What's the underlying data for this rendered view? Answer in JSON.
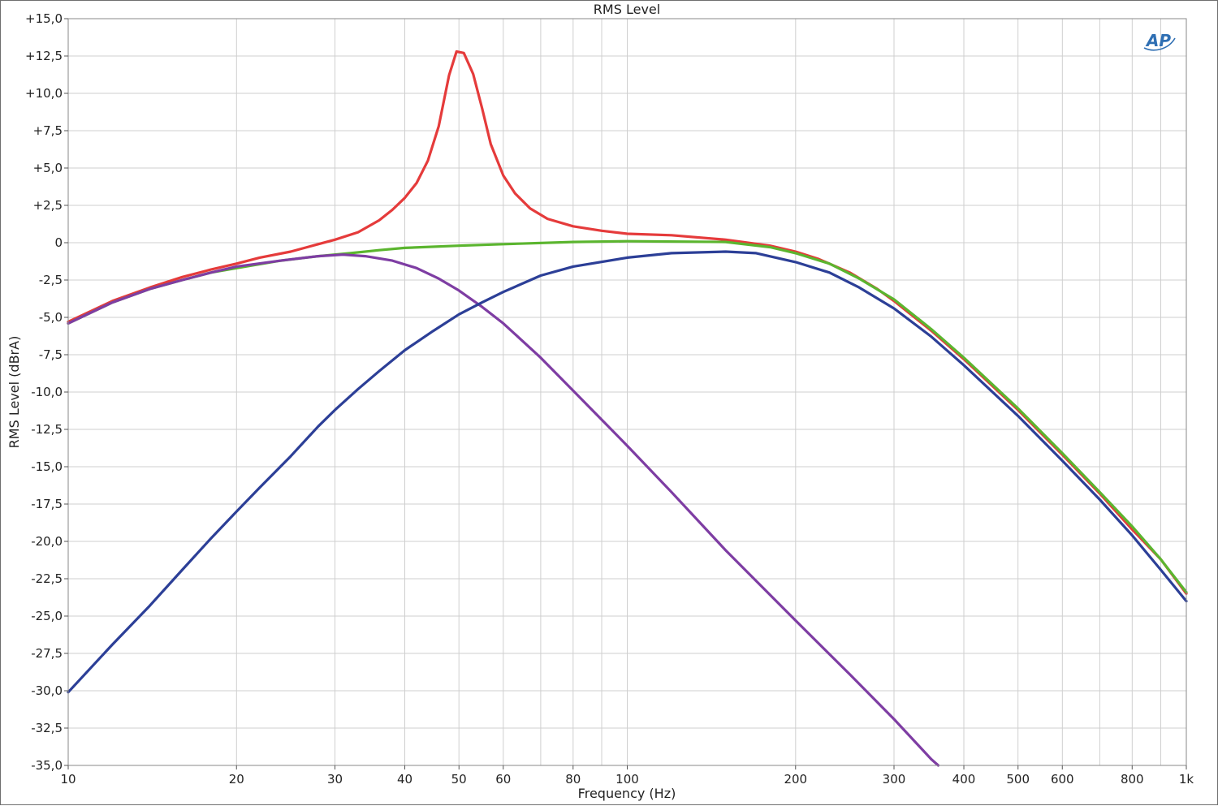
{
  "chart_data": {
    "type": "line",
    "title": "RMS Level",
    "xlabel": "Frequency (Hz)",
    "ylabel": "RMS Level (dBrA)",
    "xscale": "log",
    "xlim": [
      10,
      1000
    ],
    "ylim": [
      -35,
      15
    ],
    "grid": true,
    "legend": "none",
    "logo_text": "AP",
    "x_ticks": [
      {
        "v": 10,
        "label": "10"
      },
      {
        "v": 20,
        "label": "20"
      },
      {
        "v": 30,
        "label": "30"
      },
      {
        "v": 40,
        "label": "40"
      },
      {
        "v": 50,
        "label": "50"
      },
      {
        "v": 60,
        "label": "60"
      },
      {
        "v": 80,
        "label": "80"
      },
      {
        "v": 100,
        "label": "100"
      },
      {
        "v": 200,
        "label": "200"
      },
      {
        "v": 300,
        "label": "300"
      },
      {
        "v": 400,
        "label": "400"
      },
      {
        "v": 500,
        "label": "500"
      },
      {
        "v": 600,
        "label": "600"
      },
      {
        "v": 800,
        "label": "800"
      },
      {
        "v": 1000,
        "label": "1k"
      }
    ],
    "x_gridlines": [
      10,
      20,
      30,
      40,
      50,
      60,
      70,
      80,
      90,
      100,
      200,
      300,
      400,
      500,
      600,
      700,
      800,
      900,
      1000
    ],
    "y_ticks": [
      {
        "v": 15,
        "label": "+15,0"
      },
      {
        "v": 12.5,
        "label": "+12,5"
      },
      {
        "v": 10,
        "label": "+10,0"
      },
      {
        "v": 7.5,
        "label": "+7,5"
      },
      {
        "v": 5,
        "label": "+5,0"
      },
      {
        "v": 2.5,
        "label": "+2,5"
      },
      {
        "v": 0,
        "label": "0"
      },
      {
        "v": -2.5,
        "label": "-2,5"
      },
      {
        "v": -5,
        "label": "-5,0"
      },
      {
        "v": -7.5,
        "label": "-7,5"
      },
      {
        "v": -10,
        "label": "-10,0"
      },
      {
        "v": -12.5,
        "label": "-12,5"
      },
      {
        "v": -15,
        "label": "-15,0"
      },
      {
        "v": -17.5,
        "label": "-17,5"
      },
      {
        "v": -20,
        "label": "-20,0"
      },
      {
        "v": -22.5,
        "label": "-22,5"
      },
      {
        "v": -25,
        "label": "-25,0"
      },
      {
        "v": -27.5,
        "label": "-27,5"
      },
      {
        "v": -30,
        "label": "-30,0"
      },
      {
        "v": -32.5,
        "label": "-32,5"
      },
      {
        "v": -35,
        "label": "-35,0"
      }
    ],
    "series": [
      {
        "color": "#e53b3b",
        "points": [
          [
            10,
            -5.3
          ],
          [
            12,
            -3.9
          ],
          [
            14,
            -3.0
          ],
          [
            16,
            -2.3
          ],
          [
            18,
            -1.8
          ],
          [
            20,
            -1.4
          ],
          [
            22,
            -1.0
          ],
          [
            25,
            -0.6
          ],
          [
            28,
            -0.1
          ],
          [
            30,
            0.2
          ],
          [
            33,
            0.7
          ],
          [
            36,
            1.5
          ],
          [
            38,
            2.2
          ],
          [
            40,
            3.0
          ],
          [
            42,
            4.0
          ],
          [
            44,
            5.5
          ],
          [
            46,
            7.8
          ],
          [
            48,
            11.2
          ],
          [
            49.5,
            12.8
          ],
          [
            51,
            12.7
          ],
          [
            53,
            11.3
          ],
          [
            55,
            9.0
          ],
          [
            57,
            6.6
          ],
          [
            60,
            4.5
          ],
          [
            63,
            3.3
          ],
          [
            67,
            2.3
          ],
          [
            72,
            1.6
          ],
          [
            80,
            1.1
          ],
          [
            90,
            0.8
          ],
          [
            100,
            0.6
          ],
          [
            120,
            0.5
          ],
          [
            150,
            0.2
          ],
          [
            180,
            -0.2
          ],
          [
            200,
            -0.6
          ],
          [
            220,
            -1.1
          ],
          [
            250,
            -2.0
          ],
          [
            280,
            -3.1
          ],
          [
            300,
            -3.9
          ],
          [
            350,
            -5.9
          ],
          [
            400,
            -7.8
          ],
          [
            500,
            -11.2
          ],
          [
            600,
            -14.2
          ],
          [
            700,
            -16.8
          ],
          [
            800,
            -19.2
          ],
          [
            900,
            -21.2
          ],
          [
            1000,
            -23.5
          ]
        ]
      },
      {
        "color": "#5bb52f",
        "points": [
          [
            10,
            -5.4
          ],
          [
            12,
            -4.0
          ],
          [
            14,
            -3.1
          ],
          [
            16,
            -2.5
          ],
          [
            18,
            -2.0
          ],
          [
            20,
            -1.7
          ],
          [
            24,
            -1.2
          ],
          [
            28,
            -0.9
          ],
          [
            32,
            -0.7
          ],
          [
            36,
            -0.5
          ],
          [
            40,
            -0.35
          ],
          [
            50,
            -0.2
          ],
          [
            60,
            -0.1
          ],
          [
            80,
            0.05
          ],
          [
            100,
            0.1
          ],
          [
            150,
            0.05
          ],
          [
            180,
            -0.3
          ],
          [
            200,
            -0.7
          ],
          [
            230,
            -1.4
          ],
          [
            260,
            -2.4
          ],
          [
            300,
            -3.8
          ],
          [
            350,
            -5.8
          ],
          [
            400,
            -7.7
          ],
          [
            500,
            -11.1
          ],
          [
            600,
            -14.1
          ],
          [
            700,
            -16.7
          ],
          [
            800,
            -19.0
          ],
          [
            900,
            -21.2
          ],
          [
            1000,
            -23.4
          ]
        ]
      },
      {
        "color": "#7e3da3",
        "points": [
          [
            10,
            -5.4
          ],
          [
            12,
            -4.0
          ],
          [
            14,
            -3.1
          ],
          [
            16,
            -2.5
          ],
          [
            18,
            -2.0
          ],
          [
            20,
            -1.6
          ],
          [
            24,
            -1.2
          ],
          [
            28,
            -0.9
          ],
          [
            31,
            -0.8
          ],
          [
            34,
            -0.9
          ],
          [
            38,
            -1.2
          ],
          [
            42,
            -1.7
          ],
          [
            46,
            -2.4
          ],
          [
            50,
            -3.2
          ],
          [
            55,
            -4.3
          ],
          [
            60,
            -5.4
          ],
          [
            70,
            -7.7
          ],
          [
            80,
            -9.9
          ],
          [
            100,
            -13.6
          ],
          [
            120,
            -16.7
          ],
          [
            150,
            -20.6
          ],
          [
            200,
            -25.3
          ],
          [
            250,
            -28.9
          ],
          [
            300,
            -31.9
          ],
          [
            350,
            -34.6
          ],
          [
            360,
            -35.0
          ]
        ]
      },
      {
        "color": "#2c3f97",
        "points": [
          [
            10,
            -30.1
          ],
          [
            12,
            -26.9
          ],
          [
            14,
            -24.3
          ],
          [
            16,
            -21.9
          ],
          [
            18,
            -19.8
          ],
          [
            20,
            -18.0
          ],
          [
            22,
            -16.4
          ],
          [
            25,
            -14.3
          ],
          [
            28,
            -12.3
          ],
          [
            30,
            -11.2
          ],
          [
            33,
            -9.8
          ],
          [
            36,
            -8.6
          ],
          [
            40,
            -7.2
          ],
          [
            45,
            -5.9
          ],
          [
            50,
            -4.8
          ],
          [
            55,
            -4.0
          ],
          [
            60,
            -3.3
          ],
          [
            70,
            -2.2
          ],
          [
            80,
            -1.6
          ],
          [
            100,
            -1.0
          ],
          [
            120,
            -0.7
          ],
          [
            150,
            -0.6
          ],
          [
            170,
            -0.7
          ],
          [
            200,
            -1.3
          ],
          [
            230,
            -2.0
          ],
          [
            260,
            -3.0
          ],
          [
            300,
            -4.4
          ],
          [
            350,
            -6.3
          ],
          [
            400,
            -8.2
          ],
          [
            500,
            -11.6
          ],
          [
            600,
            -14.6
          ],
          [
            700,
            -17.2
          ],
          [
            800,
            -19.6
          ],
          [
            900,
            -21.9
          ],
          [
            1000,
            -24.0
          ]
        ]
      }
    ]
  }
}
